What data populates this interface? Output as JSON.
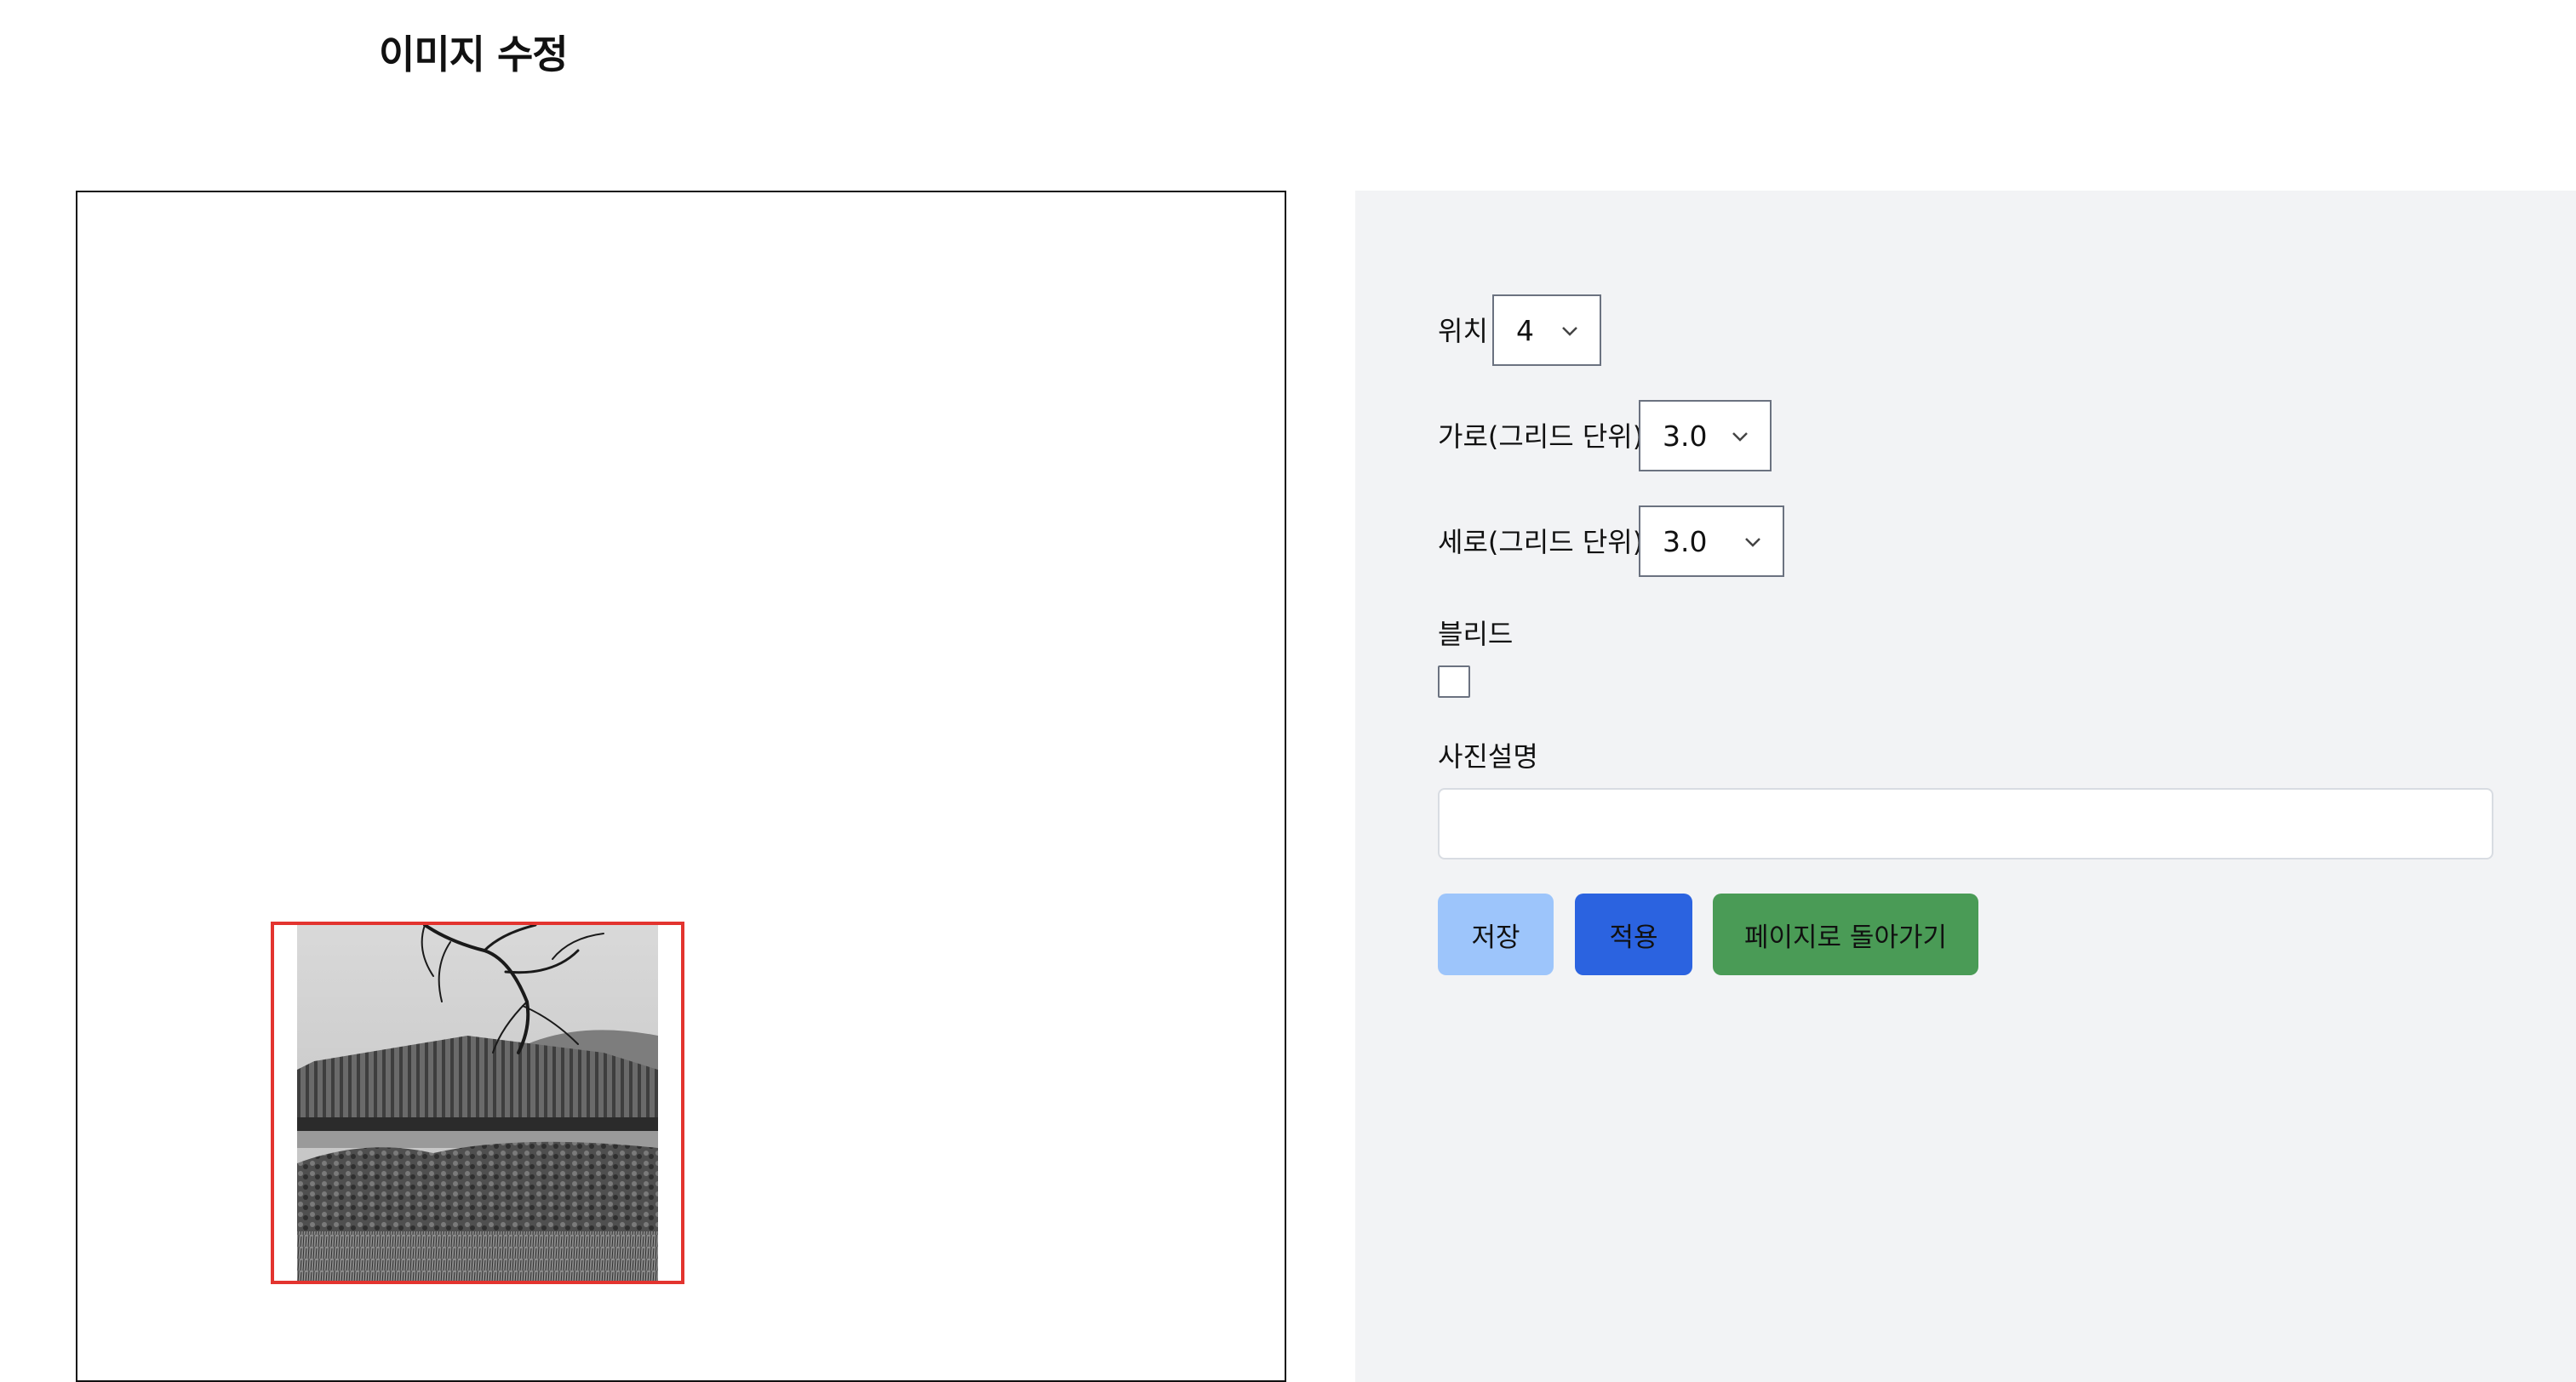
{
  "page": {
    "title": "이미지 수정"
  },
  "form": {
    "position": {
      "label": "위치",
      "value": "4"
    },
    "width": {
      "label": "가로(그리드 단위)",
      "value": "3.0"
    },
    "height": {
      "label": "세로(그리드 단위)",
      "value": "3.0"
    },
    "bleed": {
      "label": "블리드",
      "checked": false
    },
    "caption": {
      "label": "사진설명",
      "value": ""
    }
  },
  "buttons": {
    "save": "저장",
    "apply": "적용",
    "back": "페이지로 돌아가기"
  },
  "icons": {
    "select_arrow": "chevron-down-icon"
  },
  "colors": {
    "selection_border": "#e3342f",
    "panel_bg": "#f2f3f5",
    "save_bg": "#9dc5fb",
    "apply_bg": "#2b63e0",
    "back_bg": "#4a9b56"
  }
}
